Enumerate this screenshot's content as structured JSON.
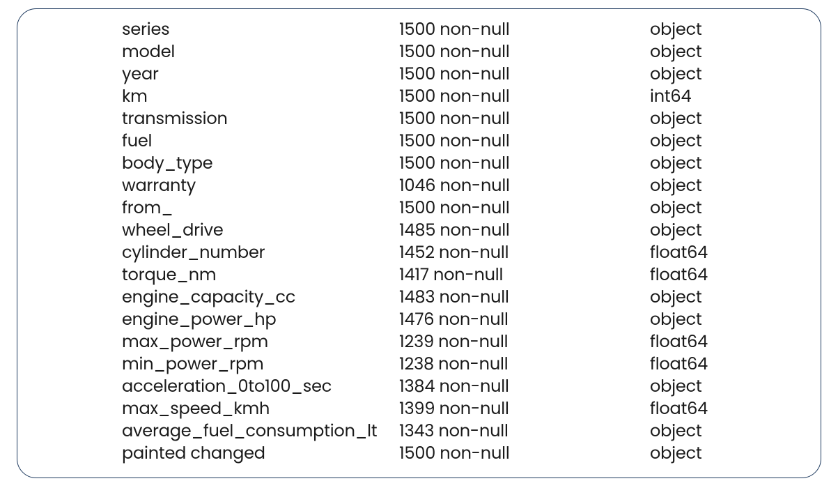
{
  "columns": [
    {
      "name": "series",
      "count": "1500 non-null",
      "dtype": "object"
    },
    {
      "name": "model",
      "count": "1500 non-null",
      "dtype": "object"
    },
    {
      "name": "year",
      "count": "1500 non-null",
      "dtype": "object"
    },
    {
      "name": "km",
      "count": "1500 non-null",
      "dtype": "int64"
    },
    {
      "name": "transmission",
      "count": "1500 non-null",
      "dtype": "object"
    },
    {
      "name": "fuel",
      "count": "1500 non-null",
      "dtype": "object"
    },
    {
      "name": "body_type",
      "count": "1500 non-null",
      "dtype": "object"
    },
    {
      "name": "warranty",
      "count": "1046 non-null",
      "dtype": "object"
    },
    {
      "name": "from_",
      "count": "1500 non-null",
      "dtype": "object"
    },
    {
      "name": "wheel_drive",
      "count": "1485 non-null",
      "dtype": "object"
    },
    {
      "name": "cylinder_number",
      "count": "1452 non-null",
      "dtype": "float64"
    },
    {
      "name": "torque_nm",
      "count": "1417 non-null",
      "dtype": "float64"
    },
    {
      "name": "engine_capacity_cc",
      "count": "1483 non-null",
      "dtype": "object"
    },
    {
      "name": "engine_power_hp",
      "count": "1476 non-null",
      "dtype": "object"
    },
    {
      "name": "max_power_rpm",
      "count": "1239 non-null",
      "dtype": "float64"
    },
    {
      "name": "min_power_rpm",
      "count": "1238 non-null",
      "dtype": "float64"
    },
    {
      "name": "acceleration_0to100_sec",
      "count": "1384 non-null",
      "dtype": "object"
    },
    {
      "name": "max_speed_kmh",
      "count": "1399 non-null",
      "dtype": "float64"
    },
    {
      "name": "average_fuel_consumption_lt",
      "count": "1343 non-null",
      "dtype": "object"
    },
    {
      "name": "painted changed",
      "count": "1500 non-null",
      "dtype": "object"
    }
  ]
}
